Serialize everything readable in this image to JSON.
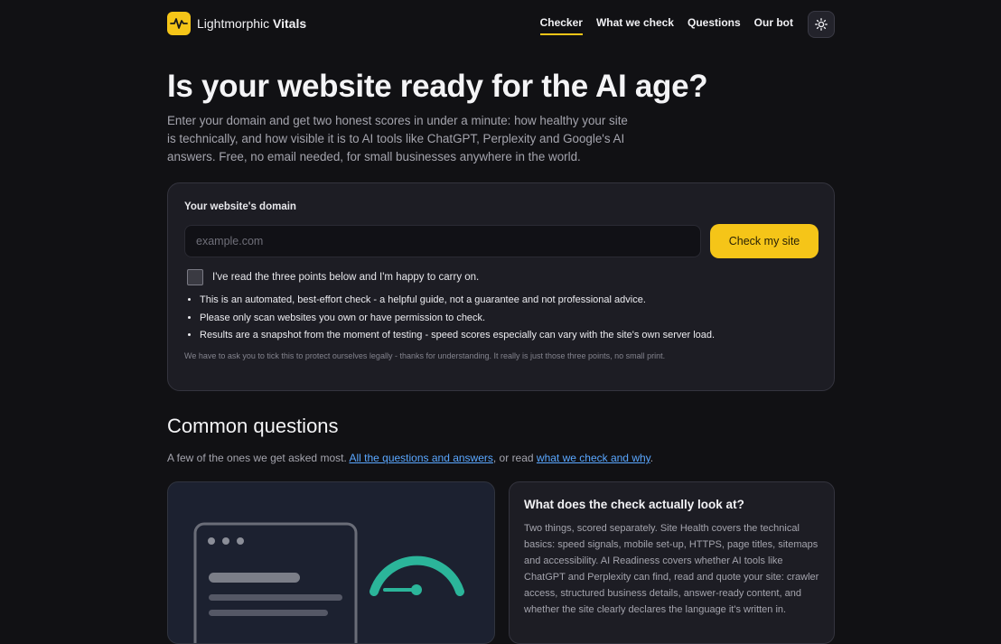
{
  "header": {
    "brand_plain": "Lightmorphic",
    "brand_bold": "Vitals",
    "logo_icon": "pulse-icon",
    "theme_icon": "sun-icon",
    "nav": [
      "Checker",
      "What we check",
      "Questions",
      "Our bot"
    ],
    "active_nav": "Checker"
  },
  "hero": {
    "title": "Is your website ready for the AI age?",
    "subtitle": "Enter your domain and get two honest scores in under a minute: how healthy your site is technically, and how visible it is to AI tools like ChatGPT, Perplexity and Google's AI answers. Free, no email needed, for small businesses anywhere in the world."
  },
  "form": {
    "label": "Your website's domain",
    "placeholder": "example.com",
    "value": "",
    "button": "Check my site",
    "consent_label": "I've read the three points below and I'm happy to carry on.",
    "consent_checked": false,
    "points": [
      "This is an automated, best-effort check - a helpful guide, not a guarantee and not professional advice.",
      "Please only scan websites you own or have permission to check.",
      "Results are a snapshot from the moment of testing - speed scores especially can vary with the site's own server load."
    ],
    "fine_print": "We have to ask you to tick this to protect ourselves legally - thanks for understanding. It really is just those three points, no small print."
  },
  "questions": {
    "title": "Common questions",
    "intro_before": "A few of the ones we get asked most. ",
    "link_all": "All the questions and answers",
    "intro_middle": ", or read ",
    "link_what": "what we check and why",
    "intro_after": ".",
    "faq": {
      "question": "What does the check actually look at?",
      "answer": "Two things, scored separately. Site Health covers the technical basics: speed signals, mobile set-up, HTTPS, page titles, sitemaps and accessibility. AI Readiness covers whether AI tools like ChatGPT and Perplexity can find, read and quote your site: crawler access, structured business details, answer-ready content, and whether the site clearly declares the language it's written in."
    }
  },
  "colors": {
    "accent": "#f5c518",
    "background": "#111114",
    "card": "#1d1d24",
    "link": "#5aa7ff",
    "gauge": "#2bb59a"
  }
}
